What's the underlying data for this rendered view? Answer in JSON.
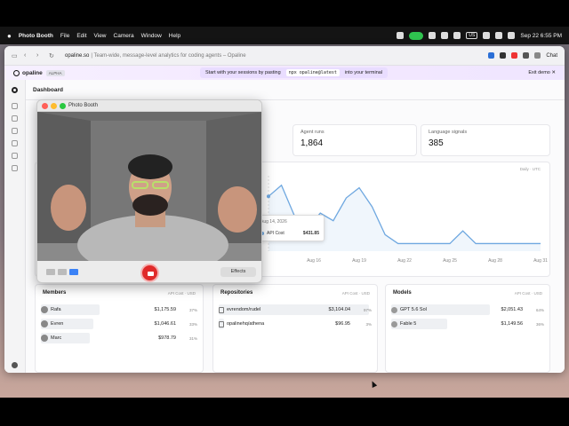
{
  "menubar": {
    "app_name": "Photo Booth",
    "menus": [
      "File",
      "Edit",
      "View",
      "Camera",
      "Window",
      "Help"
    ],
    "input_badge": "US",
    "datetime": "Sep 22  6:55 PM"
  },
  "browser": {
    "url": "opaline.so",
    "url_rest": "| Team-wide, message-level analytics for coding agents – Opaline",
    "chat_label": "Chat"
  },
  "promo": {
    "brand": "opaline",
    "badge": "ALPHA",
    "text": "Start with your sessions by pasting",
    "code": "npx opaline@latest",
    "text_after": "into your terminal",
    "exit_label": "Exit demo"
  },
  "dashboard": {
    "title": "Dashboard",
    "stats": [
      {
        "label": "Agent runs",
        "value": "1,864"
      },
      {
        "label": "Language signals",
        "value": "385"
      }
    ],
    "chart_controls": "Daily · UTC"
  },
  "chart_data": {
    "type": "line",
    "x": [
      "Aug 14",
      "Aug 16",
      "Aug 19",
      "Aug 22",
      "Aug 25",
      "Aug 28",
      "Aug 31"
    ],
    "series": [
      {
        "name": "API Cost",
        "values": [
          431.85,
          520,
          280,
          180,
          300,
          240,
          420,
          500,
          350,
          130,
          60,
          60,
          60,
          60,
          60,
          160,
          60,
          60,
          60,
          60,
          60,
          60
        ]
      }
    ],
    "tooltip": {
      "date": "Aug 14, 2026",
      "series": "API Cost",
      "value": "$431.85"
    },
    "grid": false
  },
  "members": {
    "title": "Members",
    "col": "API Cost · USD",
    "rows": [
      {
        "name": "Rafa",
        "value": "$1,175.59",
        "pct": "37%",
        "share": 0.37
      },
      {
        "name": "Evren",
        "value": "$1,046.61",
        "pct": "33%",
        "share": 0.33
      },
      {
        "name": "Marc",
        "value": "$978.79",
        "pct": "31%",
        "share": 0.31
      }
    ]
  },
  "repositories": {
    "title": "Repositories",
    "col": "API Cost · USD",
    "rows": [
      {
        "name": "evrendom/rudel",
        "value": "$3,104.04",
        "pct": "97%",
        "share": 0.97
      },
      {
        "name": "opalinehq/athena",
        "value": "$96.95",
        "pct": "3%",
        "share": 0.03
      }
    ]
  },
  "models": {
    "title": "Models",
    "col": "API Cost · USD",
    "rows": [
      {
        "name": "GPT 5.6 Sol",
        "value": "$2,051.43",
        "pct": "64%",
        "share": 0.64
      },
      {
        "name": "Fable 5",
        "value": "$1,149.56",
        "pct": "36%",
        "share": 0.36
      }
    ]
  },
  "photobooth": {
    "title": "Photo Booth",
    "effects_label": "Effects"
  },
  "colors": {
    "record": "#e02a2a",
    "line": "#6fa8e0",
    "camera_on": "#2fc24f"
  }
}
